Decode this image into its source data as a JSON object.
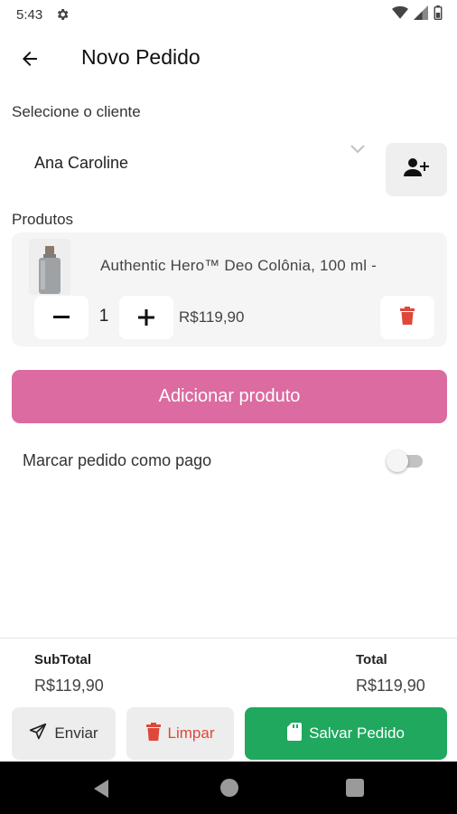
{
  "status_bar": {
    "time": "5:43",
    "icons": [
      "gear-icon",
      "wifi-icon",
      "signal-icon",
      "battery-icon"
    ]
  },
  "header": {
    "title": "Novo Pedido",
    "back_icon": "arrow-left-icon"
  },
  "client": {
    "label": "Selecione o cliente",
    "selected": "Ana Caroline",
    "add_icon": "person-add-icon"
  },
  "products": {
    "label": "Produtos",
    "items": [
      {
        "name": "Authentic Hero™ Deo Colônia, 100 ml -",
        "quantity": "1",
        "price": "R$119,90",
        "minus": "−",
        "plus": "+"
      }
    ]
  },
  "add_product": {
    "label": "Adicionar produto"
  },
  "paid_toggle": {
    "label": "Marcar pedido como pago",
    "on": false
  },
  "summary": {
    "subtotal_label": "SubTotal",
    "subtotal_value": "R$119,90",
    "total_label": "Total",
    "total_value": "R$119,90"
  },
  "actions": {
    "send_label": "Enviar",
    "clear_label": "Limpar",
    "save_label": "Salvar Pedido"
  },
  "colors": {
    "accent_pink": "#db6ba0",
    "save_green": "#1fa85e",
    "delete_red": "#e0473b"
  }
}
